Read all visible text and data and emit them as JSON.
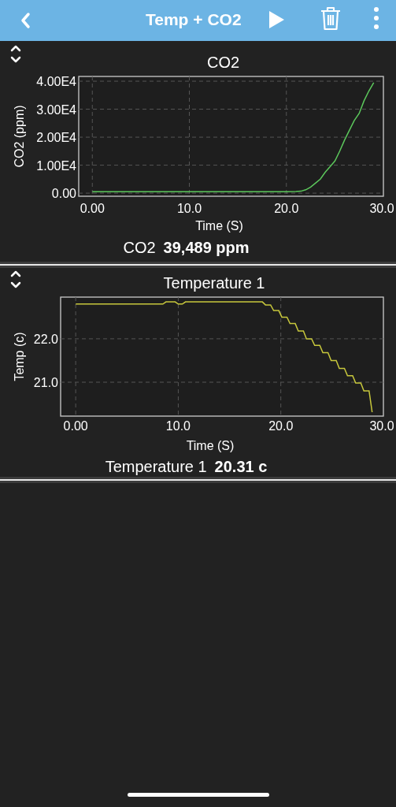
{
  "header": {
    "title": "Temp + CO2"
  },
  "panels": [
    {
      "chart_data": {
        "type": "line",
        "title": "CO2",
        "xlabel": "Time (S)",
        "ylabel": "CO2 (ppm)",
        "x": [
          0,
          5,
          10,
          15,
          20,
          21,
          21.5,
          22,
          22.5,
          23,
          23.5,
          24,
          24.5,
          25,
          25.5,
          26,
          26.5,
          27,
          27.5,
          28,
          28.5,
          29
        ],
        "series": [
          {
            "color": "#5cc85c",
            "values": [
              500,
              500,
              500,
              500,
              500,
              600,
              700,
              1200,
              2200,
              3600,
              5000,
              7500,
              9500,
              11500,
              15000,
              19000,
              22500,
              26000,
              28500,
              33000,
              36500,
              39500
            ]
          }
        ],
        "grid": true,
        "xlim": [
          -1.4,
          30
        ],
        "ylim": [
          -1100,
          41700
        ],
        "xticks": [
          {
            "value": 0,
            "label": "0.00"
          },
          {
            "value": 10,
            "label": "10.0"
          },
          {
            "value": 20,
            "label": "20.0"
          },
          {
            "value": 30,
            "label": "30.0"
          }
        ],
        "yticks": [
          {
            "value": 0,
            "label": "0.00"
          },
          {
            "value": 10000,
            "label": "1.00E4"
          },
          {
            "value": 20000,
            "label": "2.00E4"
          },
          {
            "value": 30000,
            "label": "3.00E4"
          },
          {
            "value": 40000,
            "label": "4.00E4"
          }
        ]
      },
      "reading": {
        "label": "CO2",
        "value": "39,489 ppm"
      }
    },
    {
      "chart_data": {
        "type": "line",
        "title": "Temperature 1",
        "xlabel": "Time (S)",
        "ylabel": "Temp (c)",
        "x": [
          0,
          8.5,
          8.8,
          9.7,
          10,
          10.4,
          10.7,
          18.2,
          18.5,
          19,
          19.3,
          19.8,
          20.1,
          20.6,
          20.9,
          21.4,
          21.7,
          22.2,
          22.5,
          23,
          23.3,
          23.8,
          24.1,
          24.6,
          24.9,
          25.4,
          25.7,
          26.2,
          26.5,
          27,
          27.3,
          27.8,
          28.1,
          28.6,
          28.9
        ],
        "grid": true,
        "series": [
          {
            "color": "#c8c83c",
            "values": [
              22.8,
              22.8,
              22.85,
              22.85,
              22.8,
              22.8,
              22.85,
              22.85,
              22.78,
              22.78,
              22.65,
              22.65,
              22.5,
              22.5,
              22.35,
              22.35,
              22.18,
              22.18,
              22.0,
              22.0,
              21.85,
              21.85,
              21.68,
              21.68,
              21.5,
              21.5,
              21.32,
              21.32,
              21.15,
              21.15,
              20.98,
              20.98,
              20.8,
              20.8,
              20.31
            ]
          }
        ],
        "xlim": [
          -1.47,
          30
        ],
        "ylim": [
          20.22,
          22.96
        ],
        "xticks": [
          {
            "value": 0,
            "label": "0.00"
          },
          {
            "value": 10,
            "label": "10.0"
          },
          {
            "value": 20,
            "label": "20.0"
          },
          {
            "value": 30,
            "label": "30.0"
          }
        ],
        "yticks": [
          {
            "value": 21,
            "label": "21.0"
          },
          {
            "value": 22,
            "label": "22.0"
          }
        ]
      },
      "reading": {
        "label": "Temperature 1",
        "value": "20.31 c"
      }
    }
  ]
}
